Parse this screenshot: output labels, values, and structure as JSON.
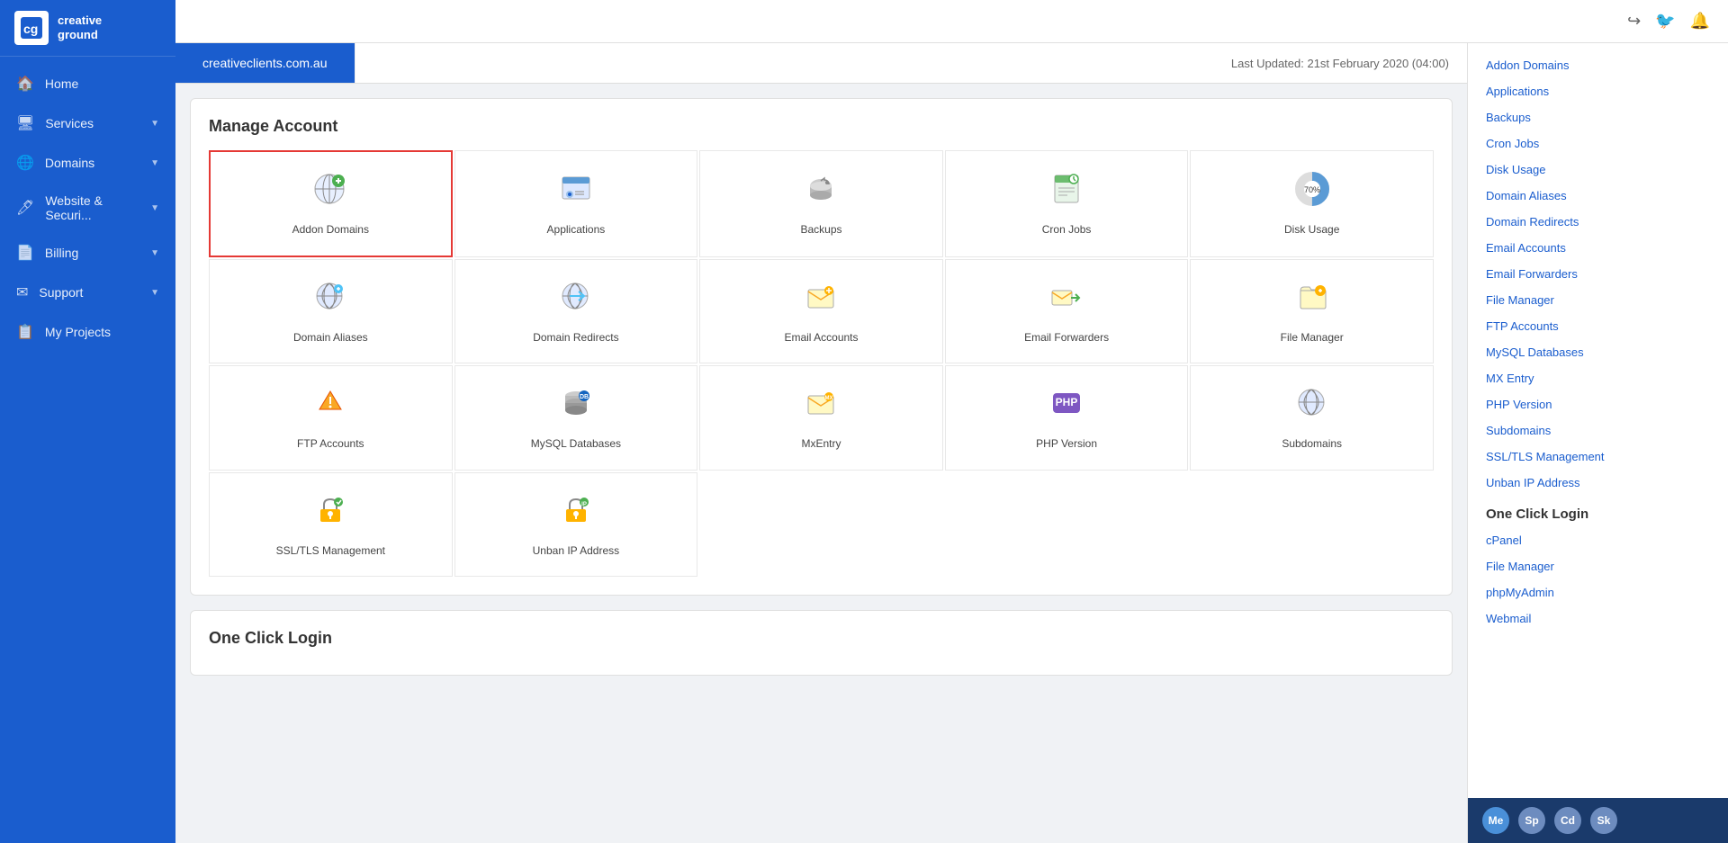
{
  "brand": {
    "logo_text_line1": "creative",
    "logo_text_line2": "ground"
  },
  "sidebar": {
    "items": [
      {
        "id": "home",
        "label": "Home",
        "icon": "🏠",
        "arrow": false
      },
      {
        "id": "services",
        "label": "Services",
        "icon": "🖥",
        "arrow": true
      },
      {
        "id": "domains",
        "label": "Domains",
        "icon": "🌐",
        "arrow": true
      },
      {
        "id": "website-security",
        "label": "Website & Securi...",
        "icon": "🖊",
        "arrow": true
      },
      {
        "id": "billing",
        "label": "Billing",
        "icon": "📄",
        "arrow": true
      },
      {
        "id": "support",
        "label": "Support",
        "icon": "✉",
        "arrow": true
      },
      {
        "id": "my-projects",
        "label": "My Projects",
        "icon": "📋",
        "arrow": false
      }
    ]
  },
  "topbar": {
    "icons": [
      "↪",
      "🐦",
      "🔔"
    ]
  },
  "domain_tabs": {
    "active_tab": "creativeclients.com.au",
    "tabs": [
      "creativeclients.com.au"
    ],
    "last_updated": "Last Updated: 21st February 2020 (04:00)"
  },
  "manage_account": {
    "title": "Manage Account",
    "items": [
      {
        "id": "addon-domains",
        "label": "Addon Domains",
        "icon_type": "addon-domains",
        "selected": true
      },
      {
        "id": "applications",
        "label": "Applications",
        "icon_type": "applications",
        "selected": false
      },
      {
        "id": "backups",
        "label": "Backups",
        "icon_type": "backups",
        "selected": false
      },
      {
        "id": "cron-jobs",
        "label": "Cron Jobs",
        "icon_type": "cron-jobs",
        "selected": false
      },
      {
        "id": "disk-usage",
        "label": "Disk Usage",
        "icon_type": "disk-usage",
        "selected": false
      },
      {
        "id": "domain-aliases",
        "label": "Domain Aliases",
        "icon_type": "domain-aliases",
        "selected": false
      },
      {
        "id": "domain-redirects",
        "label": "Domain Redirects",
        "icon_type": "domain-redirects",
        "selected": false
      },
      {
        "id": "email-accounts",
        "label": "Email Accounts",
        "icon_type": "email-accounts",
        "selected": false
      },
      {
        "id": "email-forwarders",
        "label": "Email Forwarders",
        "icon_type": "email-forwarders",
        "selected": false
      },
      {
        "id": "file-manager",
        "label": "File Manager",
        "icon_type": "file-manager",
        "selected": false
      },
      {
        "id": "ftp-accounts",
        "label": "FTP Accounts",
        "icon_type": "ftp-accounts",
        "selected": false
      },
      {
        "id": "mysql-databases",
        "label": "MySQL Databases",
        "icon_type": "mysql-databases",
        "selected": false
      },
      {
        "id": "mxentry",
        "label": "MxEntry",
        "icon_type": "mxentry",
        "selected": false
      },
      {
        "id": "php-version",
        "label": "PHP Version",
        "icon_type": "php-version",
        "selected": false
      },
      {
        "id": "subdomains",
        "label": "Subdomains",
        "icon_type": "subdomains",
        "selected": false
      },
      {
        "id": "ssl-tls",
        "label": "SSL/TLS Management",
        "icon_type": "ssl-tls",
        "selected": false
      },
      {
        "id": "unban-ip",
        "label": "Unban IP Address",
        "icon_type": "unban-ip",
        "selected": false
      }
    ]
  },
  "one_click_login": {
    "title": "One Click Login"
  },
  "right_sidebar": {
    "links": [
      "Addon Domains",
      "Applications",
      "Backups",
      "Cron Jobs",
      "Disk Usage",
      "Domain Aliases",
      "Domain Redirects",
      "Email Accounts",
      "Email Forwarders",
      "File Manager",
      "FTP Accounts",
      "MySQL Databases",
      "MX Entry",
      "PHP Version",
      "Subdomains",
      "SSL/TLS Management",
      "Unban IP Address"
    ],
    "one_click_login_title": "One Click Login",
    "one_click_links": [
      "cPanel",
      "File Manager",
      "phpMyAdmin",
      "Webmail"
    ]
  },
  "user_bar": {
    "avatars": [
      {
        "label": "Me",
        "id": "me"
      },
      {
        "label": "Sp",
        "id": "sp"
      },
      {
        "label": "Cd",
        "id": "cd"
      },
      {
        "label": "Sk",
        "id": "sk"
      }
    ]
  },
  "colors": {
    "brand_blue": "#1a5dce",
    "sidebar_bg": "#1a5dce",
    "selected_border": "#e53935",
    "link_color": "#1a5dce",
    "dark_navy": "#1a3a6b"
  }
}
